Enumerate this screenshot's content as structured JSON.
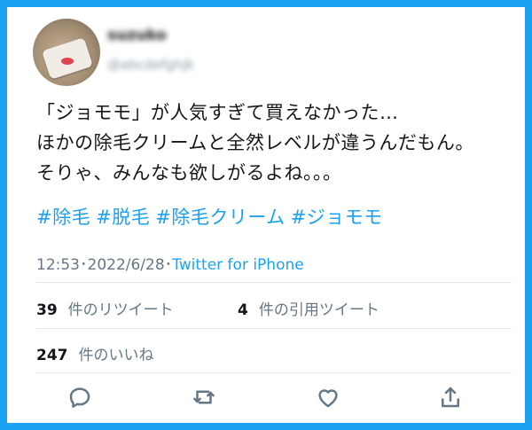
{
  "tweet": {
    "username": "suzuko",
    "handle": "@abcdefghjk",
    "text_lines": [
      "「ジョモモ」が人気すぎて買えなかった…",
      "ほかの除毛クリームと全然レベルが違うんだもん。",
      "そりゃ、みんなも欲しがるよね。。。"
    ],
    "hashtags": [
      "#除毛",
      "#脱毛",
      "#除毛クリーム",
      "#ジョモモ"
    ],
    "time": "12:53",
    "date": "2022/6/28",
    "separator": "･",
    "source": "Twitter for iPhone"
  },
  "stats": {
    "retweets": {
      "count": "39",
      "label": "件のリツイート"
    },
    "quotes": {
      "count": "4",
      "label": "件の引用ツイート"
    },
    "likes": {
      "count": "247",
      "label": "件のいいね"
    }
  },
  "actions": [
    "reply-icon",
    "retweet-icon",
    "like-icon",
    "share-icon"
  ],
  "colors": {
    "border": "#1da1f2",
    "link": "#1da1f2",
    "muted": "#657786",
    "text": "#14171a"
  }
}
